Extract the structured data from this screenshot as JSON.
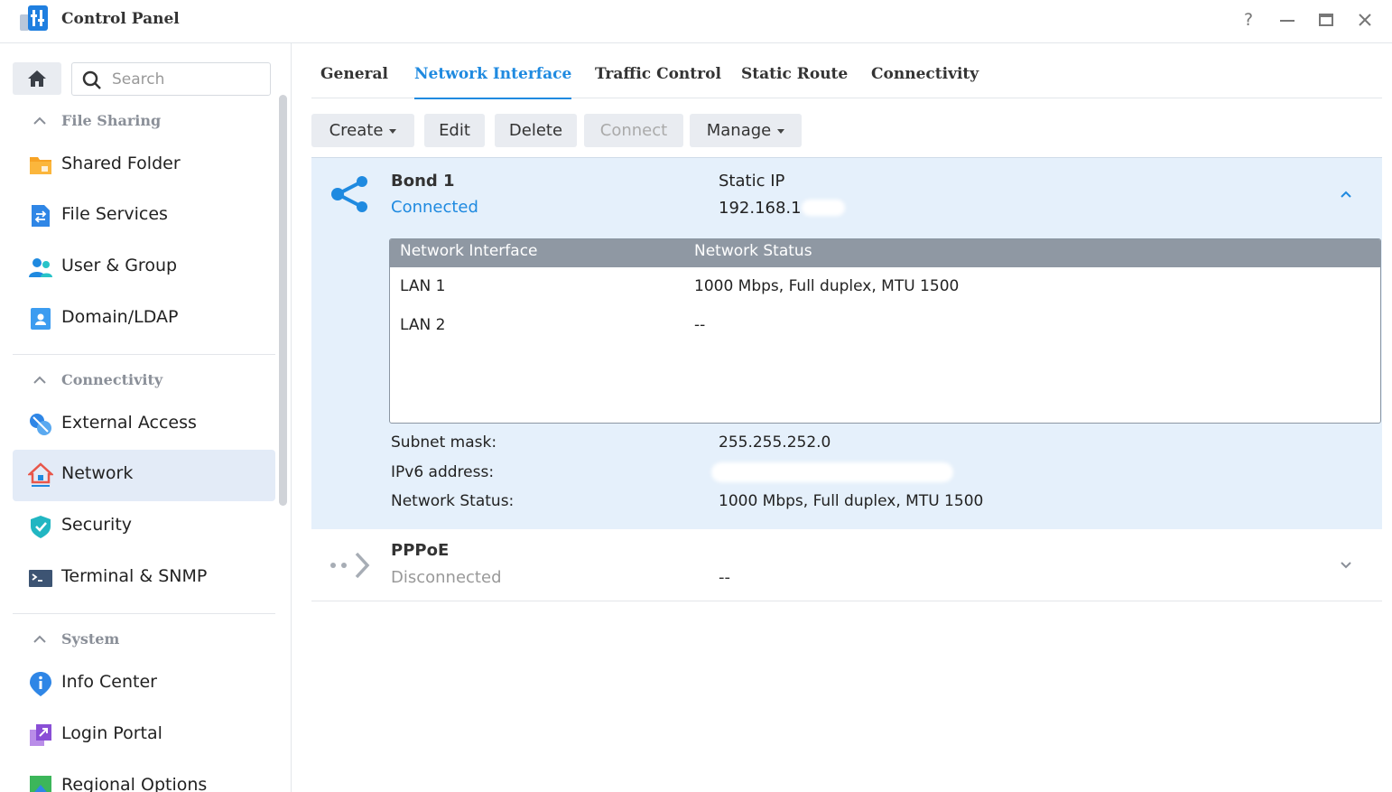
{
  "window": {
    "title": "Control Panel",
    "help": "?",
    "minimize": "—",
    "maximize": "▭",
    "close": "✕"
  },
  "sidebar": {
    "search_placeholder": "Search",
    "sections": [
      {
        "label": "File Sharing",
        "items": [
          {
            "label": "Shared Folder",
            "icon": "folder-icon"
          },
          {
            "label": "File Services",
            "icon": "file-services-icon"
          },
          {
            "label": "User & Group",
            "icon": "user-group-icon"
          },
          {
            "label": "Domain/LDAP",
            "icon": "domain-ldap-icon"
          }
        ]
      },
      {
        "label": "Connectivity",
        "items": [
          {
            "label": "External Access",
            "icon": "external-access-icon"
          },
          {
            "label": "Network",
            "icon": "network-home-icon",
            "active": true
          },
          {
            "label": "Security",
            "icon": "shield-icon"
          },
          {
            "label": "Terminal & SNMP",
            "icon": "terminal-icon"
          }
        ]
      },
      {
        "label": "System",
        "items": [
          {
            "label": "Info Center",
            "icon": "info-icon"
          },
          {
            "label": "Login Portal",
            "icon": "login-portal-icon"
          },
          {
            "label": "Regional Options",
            "icon": "regional-options-icon"
          }
        ]
      }
    ]
  },
  "tabs": [
    {
      "label": "General"
    },
    {
      "label": "Network Interface",
      "active": true
    },
    {
      "label": "Traffic Control"
    },
    {
      "label": "Static Route"
    },
    {
      "label": "Connectivity"
    }
  ],
  "toolbar": {
    "create": "Create",
    "edit": "Edit",
    "delete": "Delete",
    "connect": "Connect",
    "manage": "Manage"
  },
  "interfaces": [
    {
      "name": "Bond 1",
      "status": "Connected",
      "ip_type": "Static IP",
      "ip": "192.168.1",
      "table": {
        "headers": [
          "Network Interface",
          "Network Status"
        ],
        "rows": [
          [
            "LAN 1",
            "1000 Mbps, Full duplex, MTU 1500"
          ],
          [
            "LAN 2",
            "--"
          ]
        ]
      },
      "details": [
        {
          "label": "Subnet mask:",
          "value": "255.255.252.0"
        },
        {
          "label": "IPv6 address:",
          "value": ""
        },
        {
          "label": "Network Status:",
          "value": "1000 Mbps, Full duplex, MTU 1500"
        }
      ]
    },
    {
      "name": "PPPoE",
      "status": "Disconnected",
      "ip": "--"
    }
  ],
  "colors": {
    "accent": "#1f8ae0",
    "selected_bg": "#e5f0fb",
    "table_header": "#8f98a3"
  }
}
